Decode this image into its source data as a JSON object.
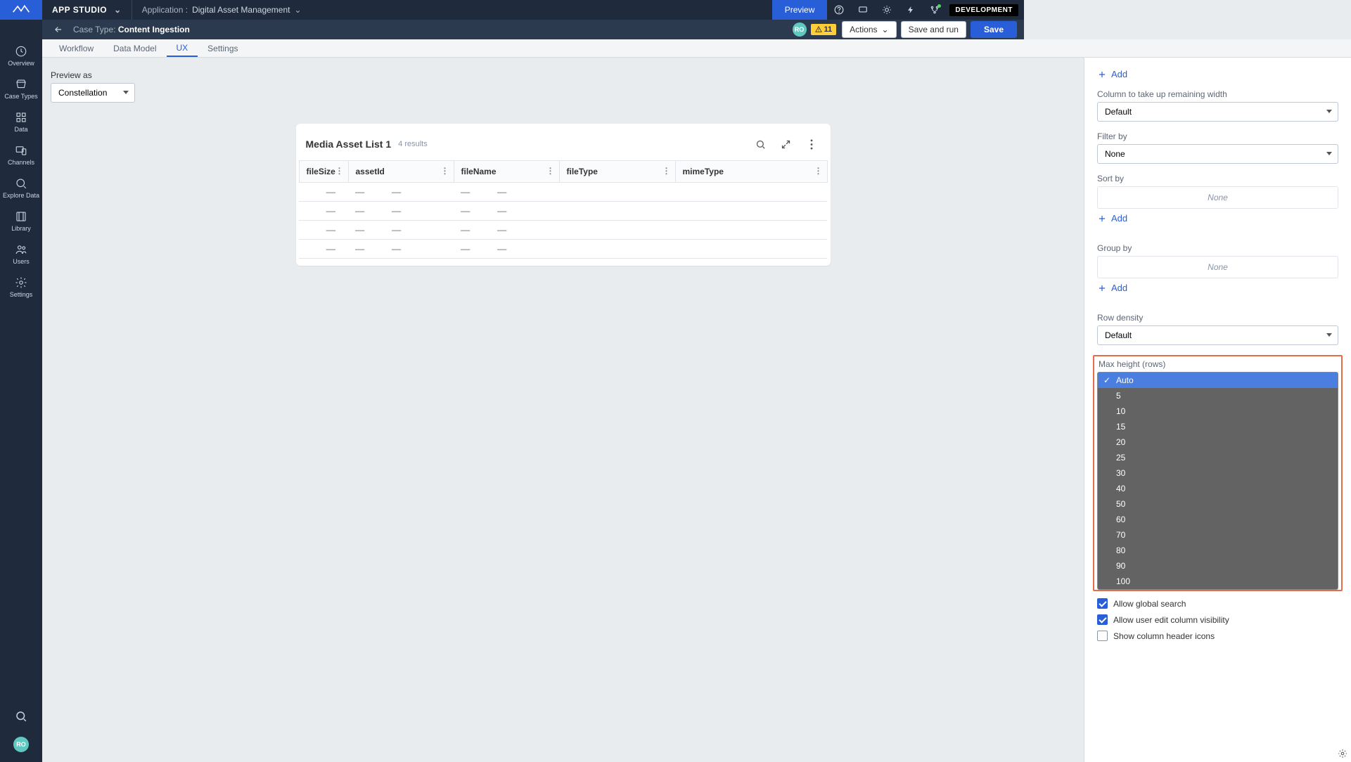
{
  "topbar": {
    "app_studio": "APP STUDIO",
    "application_label": "Application :",
    "application_name": "Digital Asset Management",
    "preview": "Preview",
    "env_badge": "DEVELOPMENT"
  },
  "casebar": {
    "case_type_label": "Case Type:",
    "case_type_name": "Content Ingestion",
    "avatar_initials": "RO",
    "warn_count": "11",
    "actions": "Actions",
    "save_and_run": "Save and run",
    "save": "Save"
  },
  "sidebar": {
    "items": [
      {
        "label": "Overview"
      },
      {
        "label": "Case Types"
      },
      {
        "label": "Data"
      },
      {
        "label": "Channels"
      },
      {
        "label": "Explore Data"
      },
      {
        "label": "Library"
      },
      {
        "label": "Users"
      },
      {
        "label": "Settings"
      }
    ],
    "avatar_initials": "RO"
  },
  "subtabs": [
    "Workflow",
    "Data Model",
    "UX",
    "Settings"
  ],
  "canvas": {
    "preview_as_label": "Preview as",
    "preview_as_value": "Constellation",
    "card_title": "Media Asset List 1",
    "card_count": "4 results",
    "columns": [
      "fileSize",
      "assetId",
      "fileName",
      "fileType",
      "mimeType"
    ],
    "empty_cell": "––"
  },
  "panel": {
    "add": "Add",
    "col_width_label": "Column to take up remaining width",
    "col_width_value": "Default",
    "filter_by_label": "Filter by",
    "filter_by_value": "None",
    "sort_by_label": "Sort by",
    "none_text": "None",
    "group_by_label": "Group by",
    "row_density_label": "Row density",
    "row_density_value": "Default",
    "max_height_label": "Max height (rows)",
    "max_height_options": [
      "Auto",
      "5",
      "10",
      "15",
      "20",
      "25",
      "30",
      "40",
      "50",
      "60",
      "70",
      "80",
      "90",
      "100"
    ],
    "allow_global_search": "Allow global search",
    "allow_col_visibility": "Allow user edit column visibility",
    "show_header_icons": "Show column header icons"
  }
}
